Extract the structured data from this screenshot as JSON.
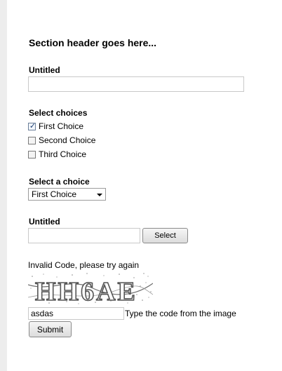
{
  "section": {
    "header": "Section header goes here..."
  },
  "field1": {
    "label": "Untitled",
    "value": ""
  },
  "checkboxes": {
    "label": "Select choices",
    "options": [
      {
        "label": "First Choice",
        "checked": true
      },
      {
        "label": "Second Choice",
        "checked": false
      },
      {
        "label": "Third Choice",
        "checked": false
      }
    ]
  },
  "dropdown": {
    "label": "Select a choice",
    "selected": "First Choice"
  },
  "field2": {
    "label": "Untitled",
    "value": "",
    "button_label": "Select"
  },
  "captcha": {
    "error_message": "Invalid Code, please try again",
    "image_text": "HH6AE",
    "input_value": "asdas",
    "hint": "Type the code from the image"
  },
  "submit": {
    "label": "Submit"
  }
}
